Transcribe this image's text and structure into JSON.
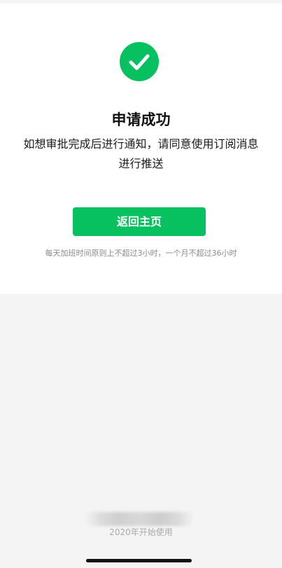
{
  "result": {
    "title": "申请成功",
    "description": "如想审批完成后进行通知，请同意使用订阅消息进行推送",
    "button_label": "返回主页",
    "tip": "每天加班时间原则上不超过3小时，一个月不超过36小时"
  },
  "footer": {
    "since_text": "2020年开始使用"
  },
  "colors": {
    "accent": "#07c160",
    "background": "#f4f4f4",
    "card": "#ffffff"
  },
  "icons": {
    "success": "check-circle-icon"
  }
}
